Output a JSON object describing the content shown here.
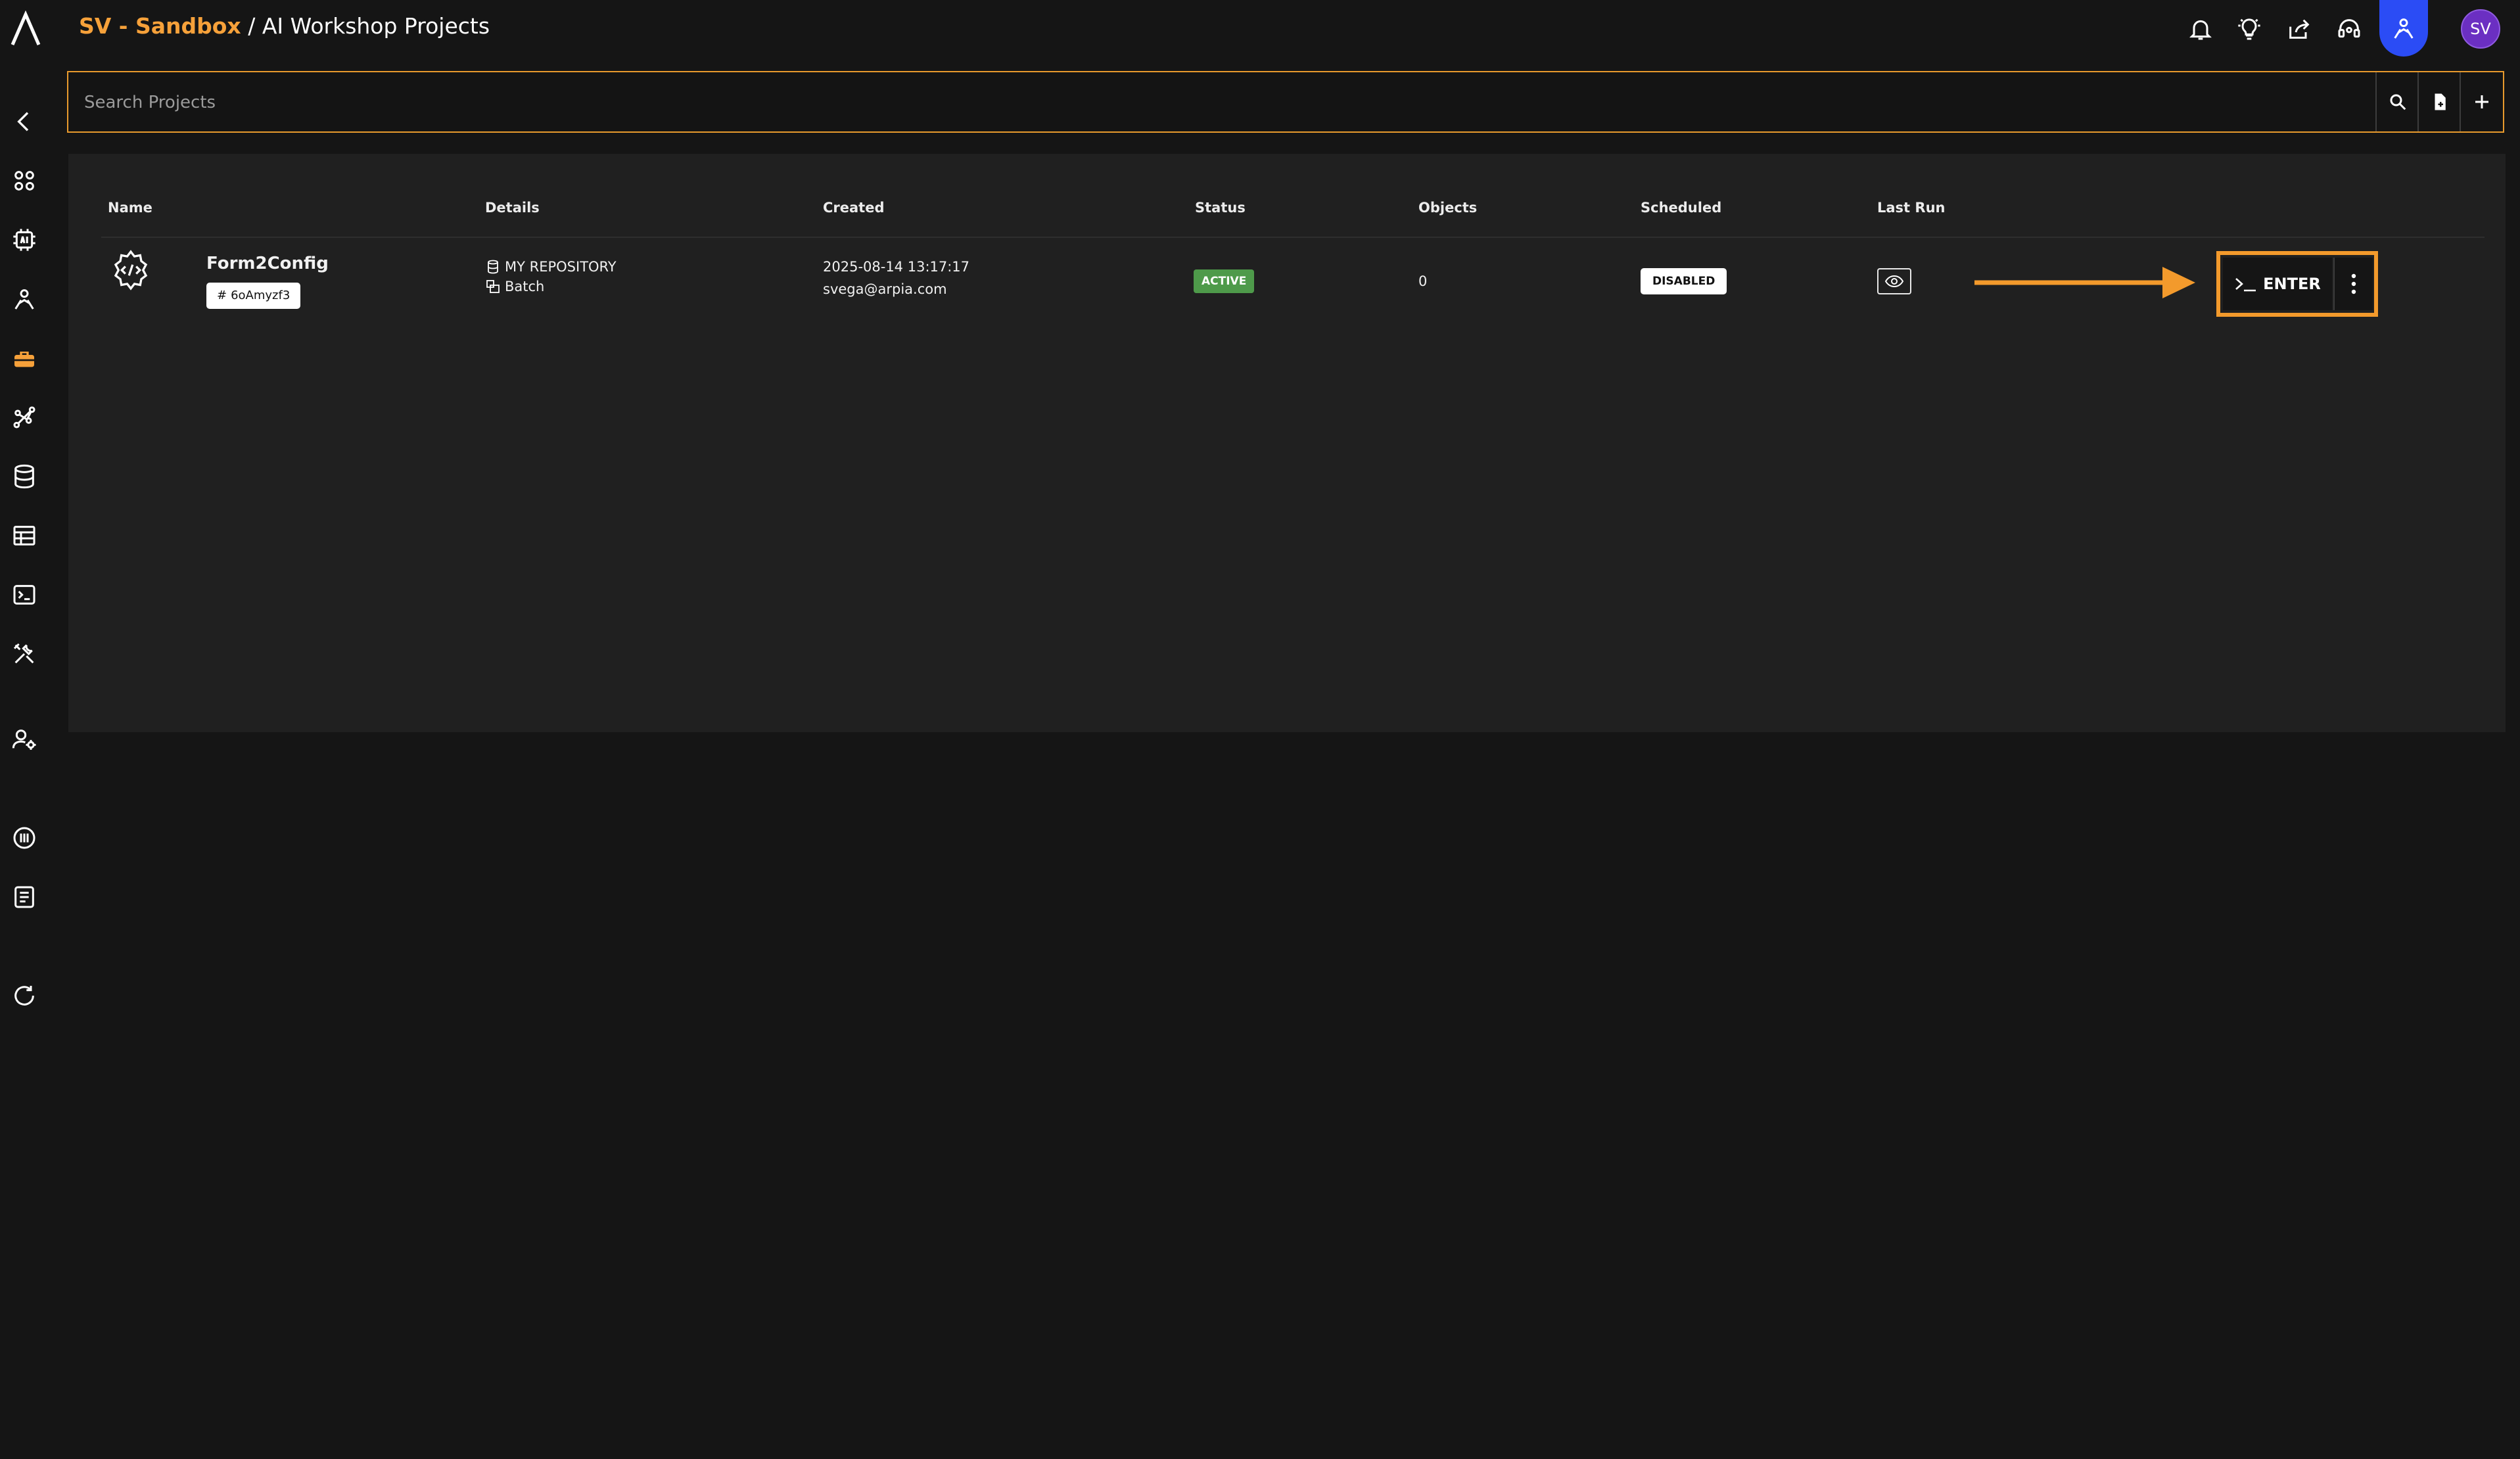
{
  "header": {
    "workspace": "SV - Sandbox",
    "separator": " / ",
    "page_title": "AI Workshop Projects",
    "avatar_initials": "SV",
    "icons": [
      "bell-icon",
      "lightbulb-icon",
      "share-icon",
      "support-headset-icon",
      "ai-agent-icon"
    ],
    "active_icon": "ai-agent-icon",
    "accent_color": "#f6a13a",
    "active_color": "#2b4cf5"
  },
  "sidebar": {
    "items": [
      "back-icon",
      "apps-grid-icon",
      "ai-chip-icon",
      "ai-agent-icon",
      "toolbox-icon",
      "graph-icon",
      "database-icon",
      "table-icon",
      "terminal-icon",
      "tools-icon",
      "user-settings-icon",
      "info-icon",
      "docs-icon",
      "refresh-icon"
    ],
    "active": "toolbox-icon"
  },
  "search": {
    "placeholder": "Search Projects",
    "value": ""
  },
  "table": {
    "columns": [
      "Name",
      "Details",
      "Created",
      "Status",
      "Objects",
      "Scheduled",
      "Last Run"
    ],
    "rows": [
      {
        "name": "Form2Config",
        "id": "6oAmyzf3",
        "repository": "MY REPOSITORY",
        "type": "Batch",
        "created_date": "2025-08-14 13:17:17",
        "created_by": "svega@arpia.com",
        "status": "ACTIVE",
        "objects": "0",
        "scheduled": "DISABLED",
        "enter_label": "ENTER"
      }
    ]
  },
  "colors": {
    "status_active": "#4e9a4a",
    "highlight": "#f39a2c"
  }
}
